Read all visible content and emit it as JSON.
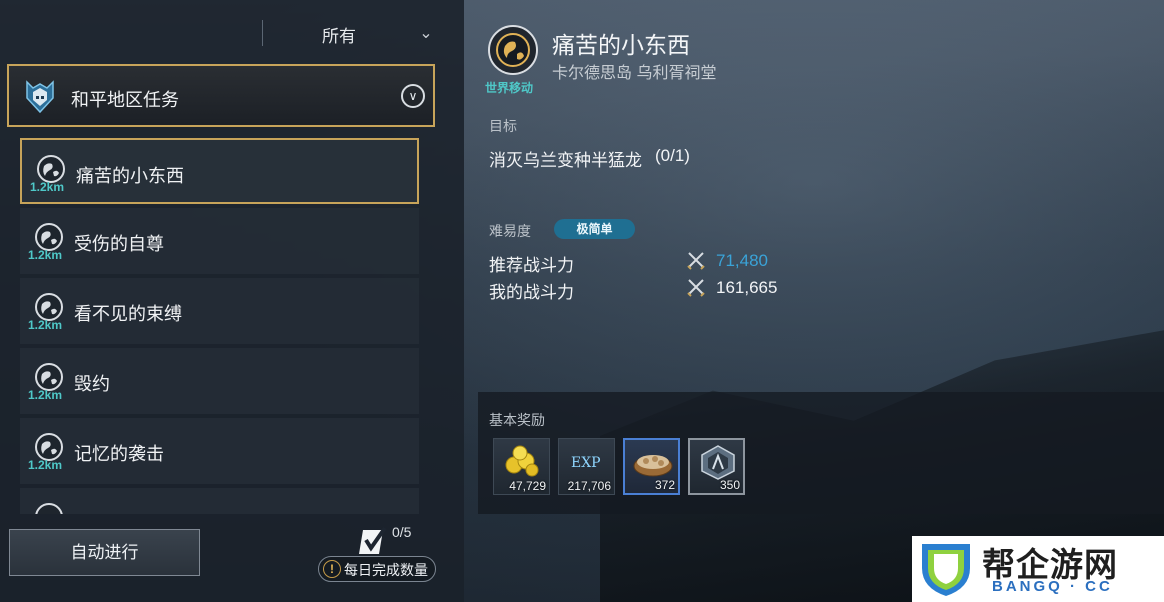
{
  "filter": {
    "selected": "所有"
  },
  "category": {
    "title": "和平地区任务"
  },
  "quests": [
    {
      "name": "痛苦的小东西",
      "distance": "1.2km",
      "selected": true
    },
    {
      "name": "受伤的自尊",
      "distance": "1.2km",
      "selected": false
    },
    {
      "name": "看不见的束缚",
      "distance": "1.2km",
      "selected": false
    },
    {
      "name": "毁约",
      "distance": "1.2km",
      "selected": false
    },
    {
      "name": "记忆的袭击",
      "distance": "1.2km",
      "selected": false
    }
  ],
  "footer": {
    "auto_button": "自动进行",
    "daily_count": "0/5",
    "daily_label": "每日完成数量"
  },
  "detail": {
    "icon_tag": "世界移动",
    "title": "痛苦的小东西",
    "location": "卡尔德思岛 乌利胥祠堂",
    "objective_label": "目标",
    "objective_text": "消灭乌兰变种半猛龙",
    "objective_progress": "(0/1)",
    "difficulty_label": "难易度",
    "difficulty_value": "极简单",
    "recommended_power_label": "推荐战斗力",
    "recommended_power_value": "71,480",
    "my_power_label": "我的战斗力",
    "my_power_value": "161,665"
  },
  "rewards": {
    "label": "基本奖励",
    "items": [
      {
        "icon": "gold-coins-icon",
        "amount": "47,729"
      },
      {
        "icon": "exp-icon",
        "text": "EXP",
        "amount": "217,706"
      },
      {
        "icon": "food-bowl-icon",
        "amount": "372"
      },
      {
        "icon": "emblem-icon",
        "amount": "350"
      }
    ]
  },
  "colors": {
    "gold_border": "#c7a45a",
    "cyan_text": "#4fc8c8",
    "recommended_power": "#3aa3d8",
    "difficulty_badge": "#1f6f92"
  },
  "watermark": {
    "title": "帮企游网",
    "subtitle": "BANGQ · CC"
  }
}
